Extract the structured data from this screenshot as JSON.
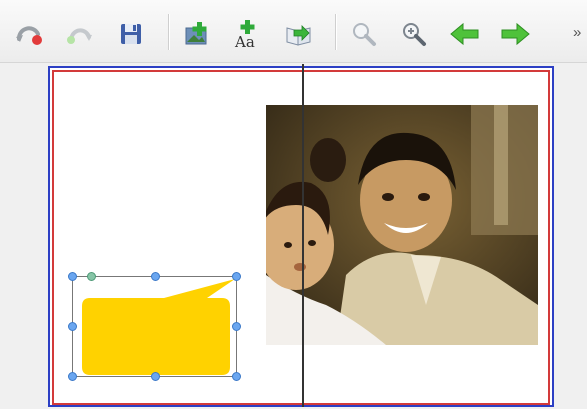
{
  "toolbar": {
    "buttons": [
      {
        "name": "undo-button",
        "icon": "undo-icon"
      },
      {
        "name": "redo-button",
        "icon": "redo-icon"
      },
      {
        "name": "save-button",
        "icon": "save-icon"
      },
      {
        "name": "add-image-button",
        "icon": "add-image-icon"
      },
      {
        "name": "add-text-button",
        "icon": "add-text-icon"
      },
      {
        "name": "import-button",
        "icon": "import-book-icon"
      },
      {
        "name": "zoom-out-button",
        "icon": "zoom-out-icon"
      },
      {
        "name": "zoom-in-button",
        "icon": "zoom-in-icon"
      },
      {
        "name": "previous-page-button",
        "icon": "arrow-left-icon"
      },
      {
        "name": "next-page-button",
        "icon": "arrow-right-icon"
      }
    ],
    "overflow_label": "»"
  },
  "add_text_glyph": "Aa",
  "colors": {
    "page_outer_border": "#2c3fc4",
    "page_inner_border": "#d33a3a",
    "bubble_fill": "#ffd200",
    "handle": "#6aa6f0",
    "arrow_green": "#4fc23a"
  }
}
